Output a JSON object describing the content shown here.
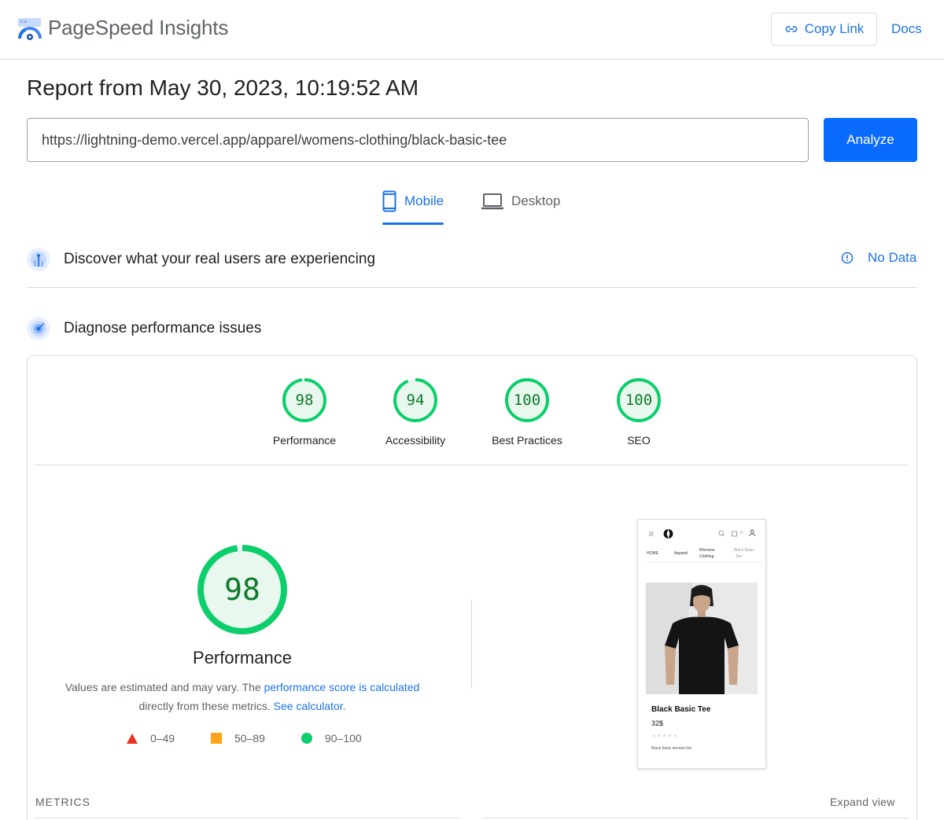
{
  "header": {
    "brand": "PageSpeed Insights",
    "copy_link_label": "Copy Link",
    "docs_label": "Docs"
  },
  "report": {
    "title": "Report from May 30, 2023, 10:19:52 AM",
    "url": "https://lightning-demo.vercel.app/apparel/womens-clothing/black-basic-tee",
    "analyze_label": "Analyze"
  },
  "tabs": [
    {
      "label": "Mobile",
      "active": true
    },
    {
      "label": "Desktop",
      "active": false
    }
  ],
  "field_data": {
    "title": "Discover what your real users are experiencing",
    "status": "No Data"
  },
  "lab": {
    "title": "Diagnose performance issues",
    "scores": [
      {
        "label": "Performance",
        "value": "98",
        "fraction": 0.98
      },
      {
        "label": "Accessibility",
        "value": "94",
        "fraction": 0.94
      },
      {
        "label": "Best Practices",
        "value": "100",
        "fraction": 1.0
      },
      {
        "label": "SEO",
        "value": "100",
        "fraction": 1.0
      }
    ],
    "main_score": {
      "value": "98",
      "fraction": 0.98,
      "label": "Performance"
    },
    "description": {
      "prefix": "Values are estimated and may vary. The ",
      "link1": "performance score is calculated",
      "middle": " directly from these metrics. ",
      "link2": "See calculator.",
      "suffix": ""
    },
    "legend": [
      "0–49",
      "50–89",
      "90–100"
    ],
    "metrics_label": "METRICS",
    "expand_label": "Expand view"
  },
  "screenshot": {
    "breadcrumbs": [
      "HOME",
      "Apparel",
      "Womens",
      "Clothing",
      "Black Basic",
      "Tee"
    ],
    "product_name": "Black Basic Tee",
    "product_price": "32$",
    "stars": "★★★★★",
    "product_desc": "Black basic woman tee",
    "cart_count": "0"
  },
  "colors": {
    "accent": "#1a73e8",
    "analyze_bg": "#0a6cff",
    "pass_green": "#0cce6b",
    "pass_text": "#0d7a2a",
    "pass_fill": "#e8f8ee",
    "average_orange": "#ffa31a",
    "fail_red": "#eb3223"
  },
  "icons": {
    "logo": "pagespeed-logo",
    "copy": "link-icon",
    "mobile": "smartphone-icon",
    "desktop": "laptop-icon",
    "field": "users-chart-icon",
    "lab": "radar-icon",
    "info": "info-circle-icon"
  }
}
